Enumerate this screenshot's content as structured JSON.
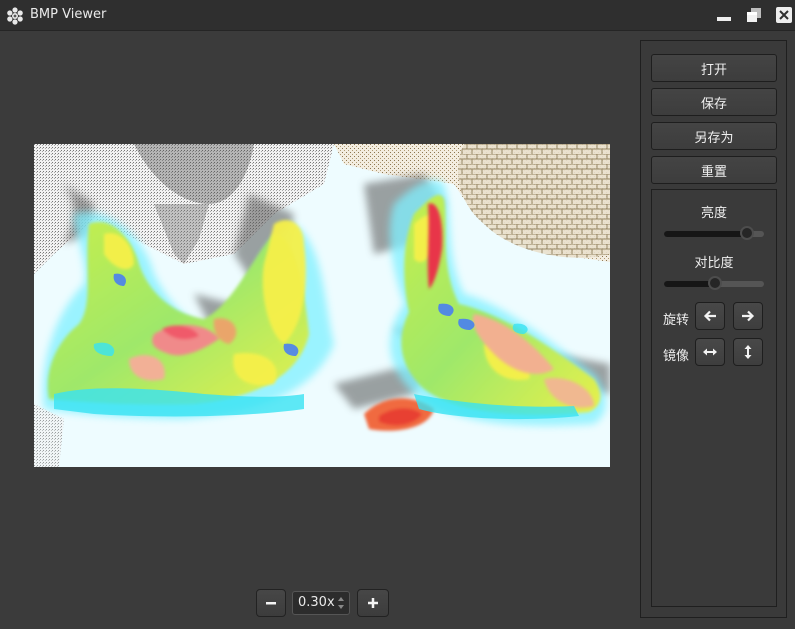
{
  "window": {
    "title": "BMP Viewer",
    "icon": "snowflake-app-icon"
  },
  "zoom": {
    "value": "0.30x",
    "minus_icon": "minus-icon",
    "plus_icon": "plus-icon"
  },
  "panel": {
    "open_label": "打开",
    "save_label": "保存",
    "save_as_label": "另存为",
    "reset_label": "重置",
    "brightness_label": "亮度",
    "brightness_level": 0.83,
    "contrast_label": "对比度",
    "contrast_level": 0.51,
    "rotate_label": "旋转",
    "mirror_label": "镜像",
    "rotate_left_icon": "arrow-left-icon",
    "rotate_right_icon": "arrow-right-icon",
    "mirror_horizontal_icon": "horizontal-flip-icon",
    "mirror_vertical_icon": "vertical-flip-icon"
  },
  "colors": {
    "background": "#3a3a3a",
    "titlebar": "#2f2f2f",
    "image_bg": "#eefcff"
  }
}
